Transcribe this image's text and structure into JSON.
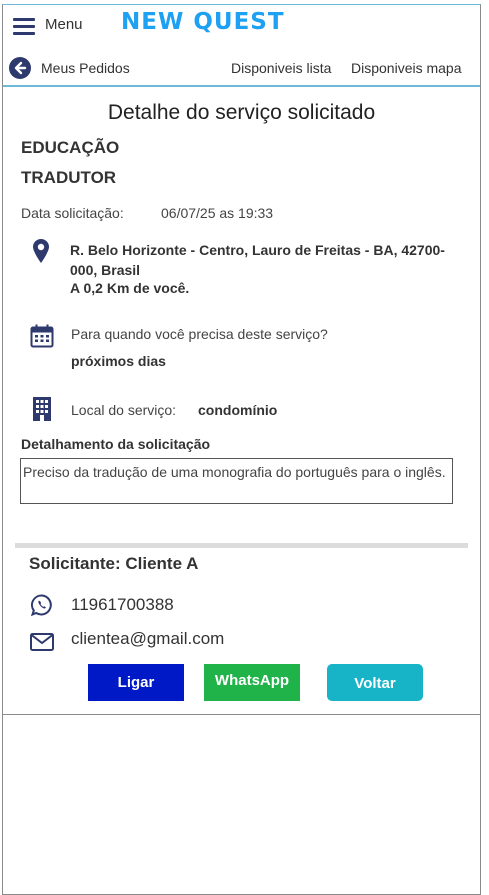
{
  "header": {
    "menu_label": "Menu",
    "logo_text": "NEW QUEST"
  },
  "nav": {
    "back_label": "Meus Pedidos",
    "list_label": "Disponiveis lista",
    "map_label": "Disponiveis mapa"
  },
  "page": {
    "title": "Detalhe do serviço solicitado",
    "category": "EDUCAÇÃO",
    "subcategory": "TRADUTOR",
    "date_label": "Data solicitação:",
    "date_value": "06/07/25 as 19:33",
    "address": "R. Belo Horizonte - Centro, Lauro de Freitas - BA, 42700-000, Brasil",
    "distance": "A 0,2 Km de você.",
    "when_question": "Para quando você precisa deste serviço?",
    "when_answer": "próximos dias",
    "local_label": "Local do serviço:",
    "local_value": "condomínio",
    "detail_heading": "Detalhamento da solicitação",
    "detail_text": "Preciso da tradução de uma monografia do português para o inglês."
  },
  "requester": {
    "title": "Solicitante: Cliente A",
    "phone": "11961700388",
    "email": "clientea@gmail.com"
  },
  "buttons": {
    "call": "Ligar",
    "whatsapp": "WhatsApp",
    "back": "Voltar"
  },
  "colors": {
    "logo": "#1ea1f2",
    "icon": "#2e3a6e",
    "call_button": "#0019c6",
    "whatsapp_button": "#20b34a",
    "back_button": "#17b3c7"
  },
  "icons": [
    "menu-icon",
    "back-arrow-icon",
    "map-pin-icon",
    "calendar-icon",
    "building-icon",
    "whatsapp-icon",
    "mail-icon"
  ]
}
